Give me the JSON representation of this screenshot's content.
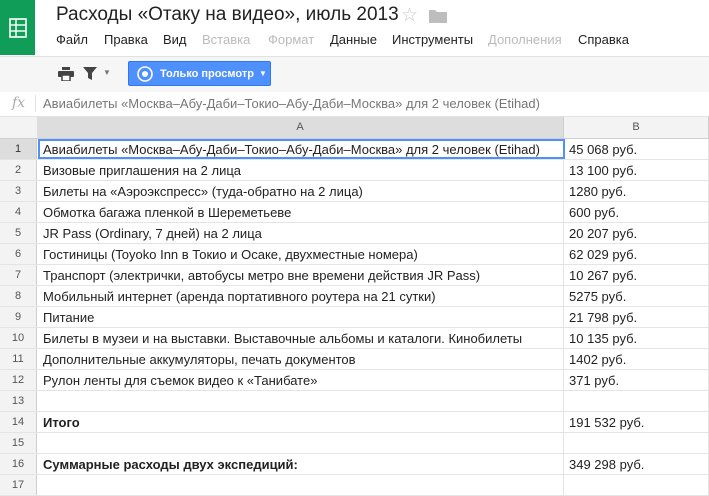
{
  "app": {
    "icon": "sheets-grid-icon",
    "brand_color": "#0f9d58",
    "title": "Расходы «Отаку на видео», июль 2013",
    "title_icons": [
      "star-icon",
      "folder-icon"
    ]
  },
  "menu": {
    "items": [
      {
        "label": "Файл",
        "enabled": true
      },
      {
        "label": "Правка",
        "enabled": true
      },
      {
        "label": "Вид",
        "enabled": true
      },
      {
        "label": "Вставка",
        "enabled": false
      },
      {
        "label": "Формат",
        "enabled": false
      },
      {
        "label": "Данные",
        "enabled": true
      },
      {
        "label": "Инструменты",
        "enabled": true
      },
      {
        "label": "Дополнения",
        "enabled": false
      },
      {
        "label": "Справка",
        "enabled": true
      }
    ]
  },
  "toolbar": {
    "icons": [
      "print-icon",
      "filter-icon",
      "chevron-down-icon"
    ],
    "view_only_label": "Только просмотр",
    "accent_color": "#4d90fe"
  },
  "formula_bar": {
    "fx_label": "fx",
    "content": "Авиабилеты «Москва–Абу-Даби–Токио–Абу-Даби–Москва» для 2 человек (Etihad)"
  },
  "sheet": {
    "columns": [
      "A",
      "B"
    ],
    "selected_cell": "A1",
    "rows": [
      {
        "num": "1",
        "a": "Авиабилеты «Москва–Абу-Даби–Токио–Абу-Даби–Москва» для 2 человек (Etihad)",
        "b": "45 068 руб.",
        "bold": false
      },
      {
        "num": "2",
        "a": "Визовые приглашения на 2 лица",
        "b": "13 100 руб.",
        "bold": false
      },
      {
        "num": "3",
        "a": "Билеты на «Аэроэкспресс» (туда-обратно на 2 лица)",
        "b": "1280 руб.",
        "bold": false
      },
      {
        "num": "4",
        "a": "Обмотка багажа пленкой в Шереметьеве",
        "b": "600 руб.",
        "bold": false
      },
      {
        "num": "5",
        "a": "JR Pass (Ordinary, 7 дней) на 2 лица",
        "b": "20 207 руб.",
        "bold": false
      },
      {
        "num": "6",
        "a": "Гостиницы (Toyoko Inn в Токио и Осаке, двухместные номера)",
        "b": "62 029 руб.",
        "bold": false
      },
      {
        "num": "7",
        "a": "Транспорт (электрички, автобусы метро вне времени действия JR Pass)",
        "b": "10 267 руб.",
        "bold": false
      },
      {
        "num": "8",
        "a": "Мобильный интернет (аренда портативного роутера на 21 сутки)",
        "b": "5275 руб.",
        "bold": false
      },
      {
        "num": "9",
        "a": "Питание",
        "b": "21 798 руб.",
        "bold": false
      },
      {
        "num": "10",
        "a": "Билеты в музеи и на выставки. Выставочные альбомы и каталоги. Кинобилеты",
        "b": "10 135 руб.",
        "bold": false
      },
      {
        "num": "11",
        "a": "Дополнительные аккумуляторы, печать документов",
        "b": "1402 руб.",
        "bold": false
      },
      {
        "num": "12",
        "a": "Рулон ленты для съемок видео к «Танибате»",
        "b": "371 руб.",
        "bold": false
      },
      {
        "num": "13",
        "a": "",
        "b": "",
        "bold": false
      },
      {
        "num": "14",
        "a": "Итого",
        "b": "191 532 руб.",
        "bold": true
      },
      {
        "num": "15",
        "a": "",
        "b": "",
        "bold": false
      },
      {
        "num": "16",
        "a": "Суммарные расходы двух экспедиций:",
        "b": "349 298 руб.",
        "bold": true
      },
      {
        "num": "17",
        "a": "",
        "b": "",
        "bold": false
      }
    ]
  }
}
